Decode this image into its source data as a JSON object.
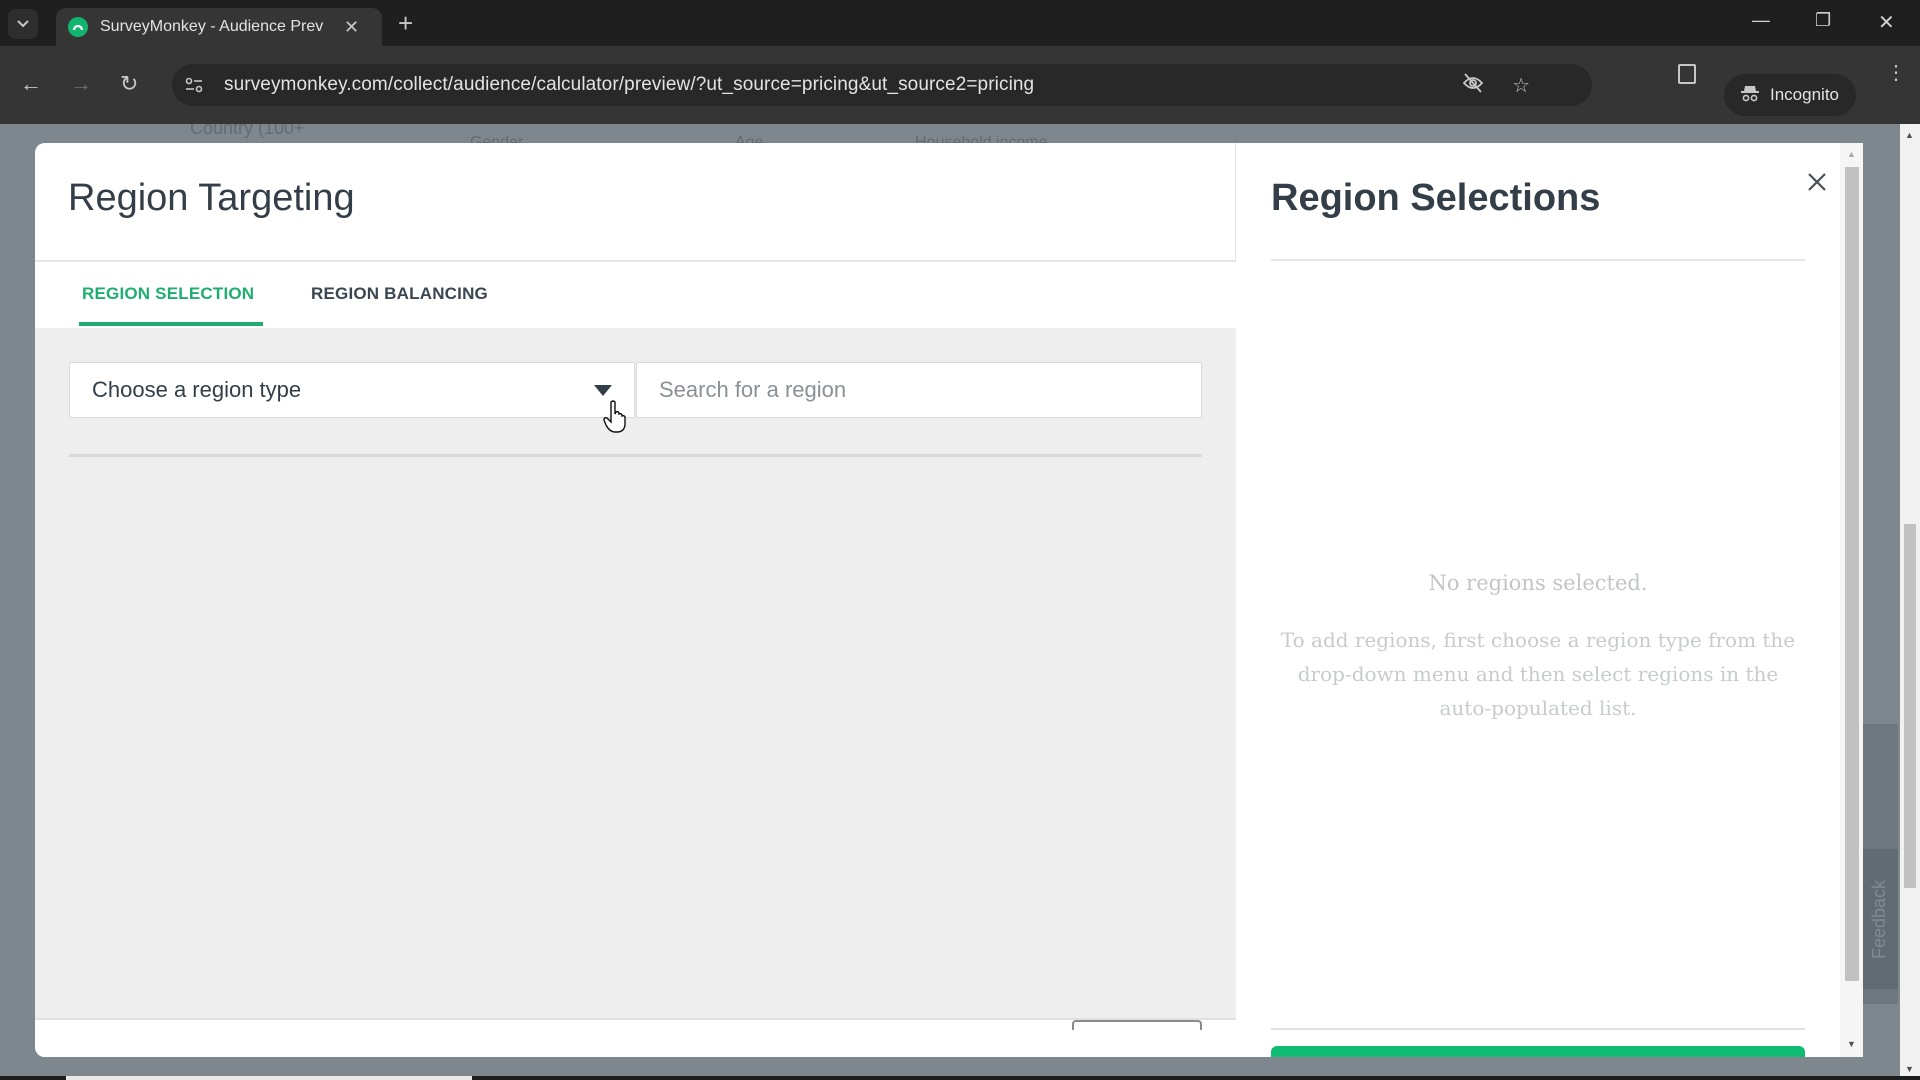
{
  "browser": {
    "tab_title": "SurveyMonkey - Audience Prev",
    "tab_close_glyph": "✕",
    "new_tab_glyph": "+",
    "url": "surveymonkey.com/collect/audience/calculator/preview/?ut_source=pricing&ut_source2=pricing",
    "incognito_label": "Incognito",
    "icons": {
      "tab_list": "chevron-down-icon",
      "back": "←",
      "forward": "→",
      "reload": "↻",
      "site_info": "⚙",
      "eye_off": "eye-off-icon",
      "star": "☆",
      "menu": "⋮",
      "minimize": "—",
      "maximize": "❐",
      "close": "✕"
    }
  },
  "background_page": {
    "country_label": "Country (100+",
    "column_headers": [
      "Gender",
      "Age",
      "Household income"
    ]
  },
  "modal": {
    "title": "Region Targeting",
    "tabs": [
      {
        "label": "REGION SELECTION",
        "active": true
      },
      {
        "label": "REGION BALANCING",
        "active": false
      }
    ],
    "region_type_select": {
      "value": "Choose a region type"
    },
    "region_search": {
      "placeholder": "Search for a region",
      "value": ""
    },
    "selections_panel": {
      "title": "Region Selections",
      "empty_title": "No regions selected.",
      "empty_description": "To add regions, first choose a region type from the drop-down menu and then select regions in the auto-populated list."
    },
    "close_label": "Close"
  },
  "feedback_label": "Feedback",
  "colors": {
    "accent_green": "#1fae70",
    "primary_button": "#10bb72",
    "overlay": "#7e878d",
    "text_dark": "#333e48"
  }
}
